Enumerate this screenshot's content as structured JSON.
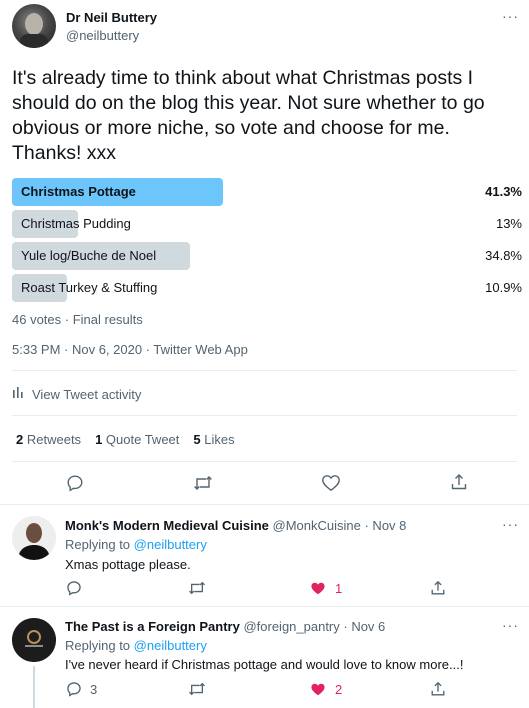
{
  "main_tweet": {
    "author_name": "Dr Neil Buttery",
    "author_handle": "@neilbuttery",
    "more_glyph": "···",
    "text": "It's already time to think about what Christmas posts I should do on the blog this year. Not sure whether to go obvious or more niche, so vote and choose for me. Thanks! xxx",
    "poll": {
      "options": [
        {
          "label": "Christmas Pottage",
          "percent": "41.3%",
          "value": 41.3,
          "winner": true
        },
        {
          "label": "Christmas Pudding",
          "percent": "13%",
          "value": 13,
          "winner": false
        },
        {
          "label": "Yule log/Buche de Noel",
          "percent": "34.8%",
          "value": 34.8,
          "winner": false
        },
        {
          "label": "Roast Turkey & Stuffing",
          "percent": "10.9%",
          "value": 10.9,
          "winner": false
        }
      ],
      "summary": "46 votes · Final results"
    },
    "timestamp": "5:33 PM · Nov 6, 2020 · Twitter Web App",
    "activity_label": "View Tweet activity",
    "stats": {
      "retweets_count": "2",
      "retweets_label": "Retweets",
      "quotes_count": "1",
      "quotes_label": "Quote Tweet",
      "likes_count": "5",
      "likes_label": "Likes"
    }
  },
  "replies": [
    {
      "author_name": "Monk's Modern Medieval Cuisine",
      "meta": "@MonkCuisine · Nov 8",
      "replying_prefix": "Replying to",
      "replying_handle": "@neilbuttery",
      "text": "Xmas pottage please.",
      "reply_count": "",
      "like_count": "1"
    },
    {
      "author_name": "The Past is a Foreign Pantry",
      "meta": "@foreign_pantry · Nov 6",
      "replying_prefix": "Replying to",
      "replying_handle": "@neilbuttery",
      "text": "I've never heard if Christmas pottage and would love to know more...!",
      "reply_count": "3",
      "like_count": "2"
    }
  ],
  "colors": {
    "accent": "#1da1f2",
    "winner_bar": "#6cc5fb",
    "loser_bar": "#cfd9de",
    "like": "#e0245e",
    "muted": "#536471"
  },
  "icons": [
    "reply-icon",
    "retweet-icon",
    "like-icon",
    "share-icon",
    "activity-icon",
    "more-icon",
    "heart-filled-icon"
  ]
}
